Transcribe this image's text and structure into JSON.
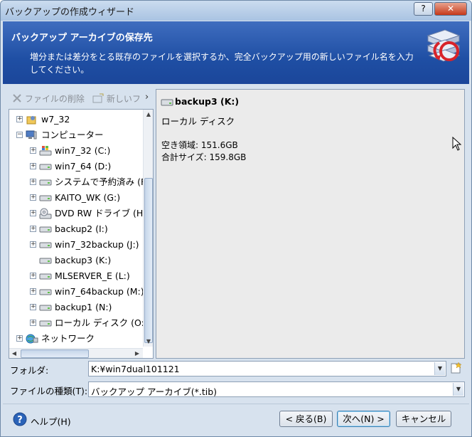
{
  "window": {
    "title": "バックアップの作成ウィザード",
    "help_button": "?",
    "close_button": "✕"
  },
  "header": {
    "title": "バックアップ アーカイブの保存先",
    "description": "増分または差分をとる既存のファイルを選択するか、完全バックアップ用の新しいファイル名を入力してください。"
  },
  "toolbar": {
    "delete_label": "ファイルの削除",
    "new_label": "新しいフ",
    "more_glyph": "›"
  },
  "tree": {
    "items": [
      {
        "label": "w7_32",
        "icon": "user-folder-icon",
        "level": 0,
        "expander": "+"
      },
      {
        "label": "コンピューター",
        "icon": "computer-icon",
        "level": 0,
        "expander": "−"
      },
      {
        "label": "win7_32 (C:)",
        "icon": "system-drive-icon",
        "level": 1,
        "expander": "+"
      },
      {
        "label": "win7_64 (D:)",
        "icon": "drive-icon",
        "level": 1,
        "expander": "+"
      },
      {
        "label": "システムで予約済み (F",
        "icon": "drive-icon",
        "level": 1,
        "expander": "+"
      },
      {
        "label": "KAITO_WK (G:)",
        "icon": "drive-icon",
        "level": 1,
        "expander": "+"
      },
      {
        "label": "DVD RW ドライブ (H",
        "icon": "dvd-drive-icon",
        "level": 1,
        "expander": "+"
      },
      {
        "label": "backup2 (I:)",
        "icon": "drive-icon",
        "level": 1,
        "expander": "+"
      },
      {
        "label": "win7_32backup (J:)",
        "icon": "drive-icon",
        "level": 1,
        "expander": "+"
      },
      {
        "label": "backup3 (K:)",
        "icon": "drive-icon",
        "level": 1,
        "expander": ""
      },
      {
        "label": "MLSERVER_E (L:)",
        "icon": "drive-icon",
        "level": 1,
        "expander": "+"
      },
      {
        "label": "win7_64backup (M:)",
        "icon": "drive-icon",
        "level": 1,
        "expander": "+"
      },
      {
        "label": "backup1 (N:)",
        "icon": "drive-icon",
        "level": 1,
        "expander": "+"
      },
      {
        "label": "ローカル ディスク (O:",
        "icon": "drive-icon",
        "level": 1,
        "expander": "+"
      },
      {
        "label": "ネットワーク",
        "icon": "network-icon",
        "level": 0,
        "expander": "+"
      }
    ]
  },
  "details": {
    "drive_name": "backup3 (K:)",
    "drive_type": "ローカル ディスク",
    "free_space": "空き領域: 151.6GB",
    "total_size": "合計サイズ: 159.8GB"
  },
  "form": {
    "folder_label": "フォルダ:",
    "folder_value": "K:¥win7dual101121",
    "filetype_label": "ファイルの種類(T):",
    "filetype_value": "バックアップ アーカイブ(*.tib)"
  },
  "footer": {
    "help_label": "ヘルプ(H)",
    "back_label": "< 戻る(B)",
    "next_label": "次へ(N) >",
    "cancel_label": "キャンセル"
  },
  "colors": {
    "header_blue": "#1f4fa4",
    "window_bg": "#d7e2ee",
    "details_bg": "#ebebeb"
  }
}
